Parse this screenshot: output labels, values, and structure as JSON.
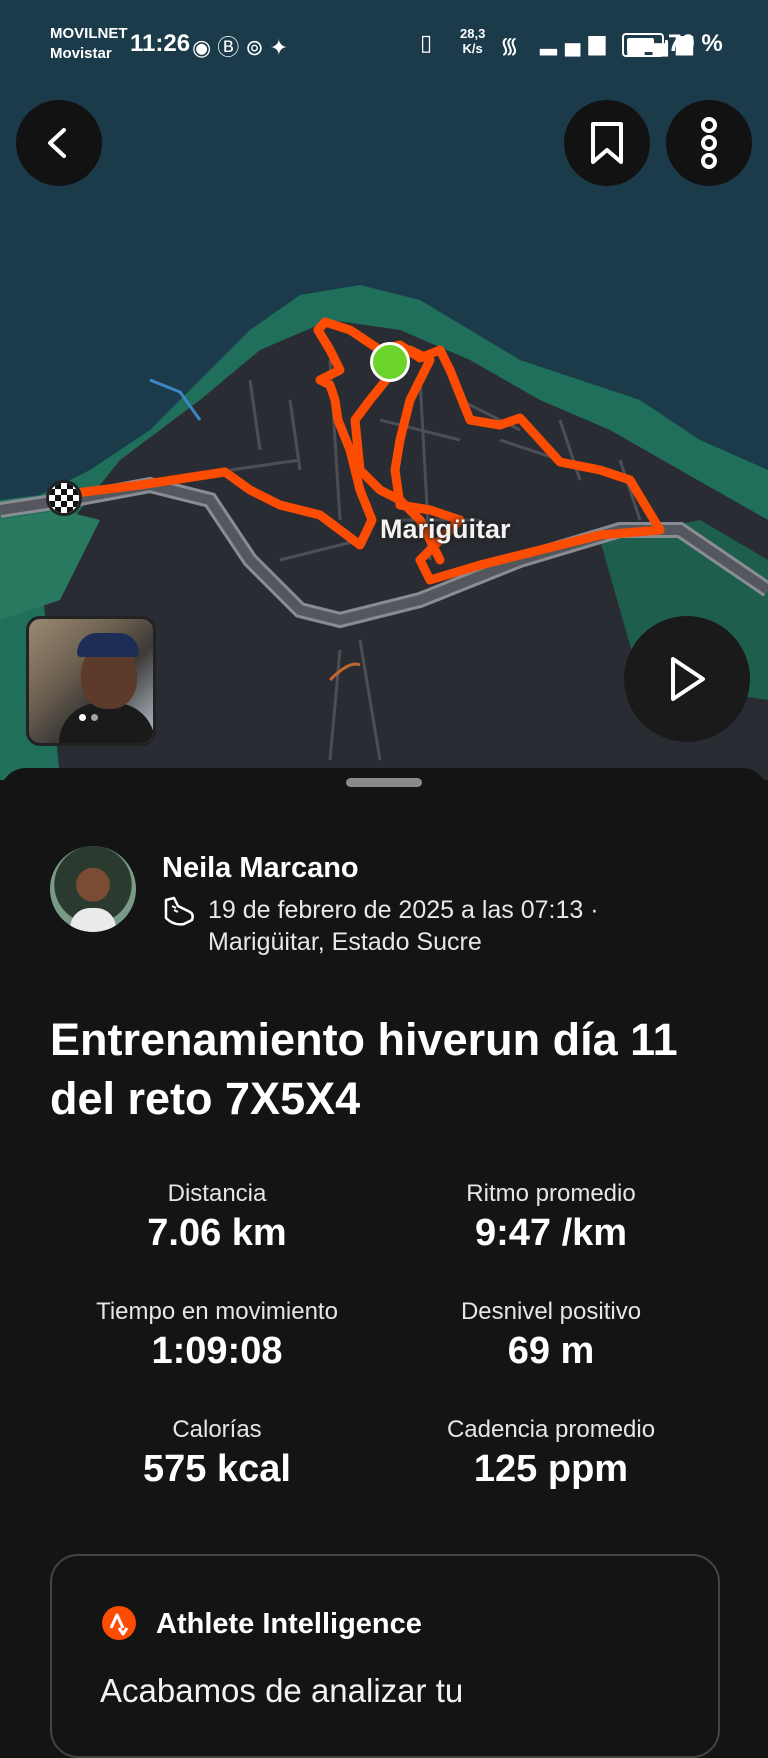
{
  "status_bar": {
    "carrier_1": "MOVILNET",
    "carrier_2": "Movistar",
    "time": "11:26",
    "net_speed_value": "28,3",
    "net_speed_unit": "K/s",
    "battery": "70 %"
  },
  "map": {
    "place_label": "Marigüitar"
  },
  "activity": {
    "athlete_name": "Neila Marcano",
    "date_line": "19 de febrero de 2025 a las 07:13 ·",
    "location_line": "Marigüitar, Estado Sucre",
    "title": "Entrenamiento hiverun día 11 del reto 7X5X4",
    "stats": [
      {
        "label": "Distancia",
        "value": "7.06 km"
      },
      {
        "label": "Ritmo promedio",
        "value": "9:47 /km"
      },
      {
        "label": "Tiempo en movimiento",
        "value": "1:09:08"
      },
      {
        "label": "Desnivel positivo",
        "value": "69 m"
      },
      {
        "label": "Calorías",
        "value": "575 kcal"
      },
      {
        "label": "Cadencia promedio",
        "value": "125 ppm"
      }
    ]
  },
  "athlete_intelligence": {
    "title": "Athlete Intelligence",
    "text": "Acabamos de analizar tu"
  },
  "colors": {
    "route": "#fc4c02",
    "start_marker": "#6bd42a",
    "background": "#141414"
  }
}
